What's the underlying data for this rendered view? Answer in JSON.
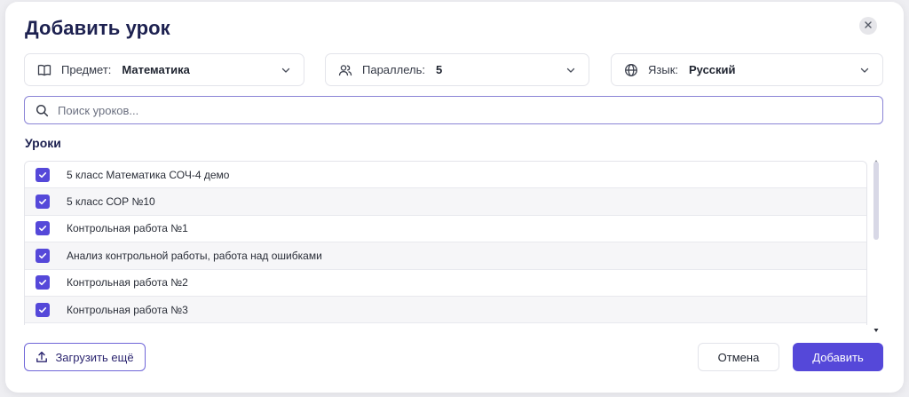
{
  "modal": {
    "title": "Добавить урок",
    "close_icon": "close-icon"
  },
  "filters": {
    "subject": {
      "label": "Предмет:",
      "value": "Математика",
      "icon": "book-icon"
    },
    "parallel": {
      "label": "Параллель:",
      "value": "5",
      "icon": "users-icon"
    },
    "language": {
      "label": "Язык:",
      "value": "Русский",
      "icon": "globe-icon"
    }
  },
  "search": {
    "placeholder": "Поиск уроков...",
    "value": ""
  },
  "lessons": {
    "title": "Уроки",
    "items": [
      {
        "label": "5 класс Математика СОЧ-4 демо",
        "checked": true
      },
      {
        "label": "5 класс СОР №10",
        "checked": true
      },
      {
        "label": "Контрольная работа №1",
        "checked": true
      },
      {
        "label": "Анализ контрольной работы, работа над ошибками",
        "checked": true
      },
      {
        "label": "Контрольная работа №2",
        "checked": true
      },
      {
        "label": "Контрольная работа №3",
        "checked": true
      }
    ]
  },
  "footer": {
    "load_more_label": "Загрузить ещё",
    "cancel_label": "Отмена",
    "add_label": "Добавить"
  },
  "colors": {
    "accent": "#5548d9",
    "title": "#1d2150",
    "background": "#eeeef2"
  }
}
